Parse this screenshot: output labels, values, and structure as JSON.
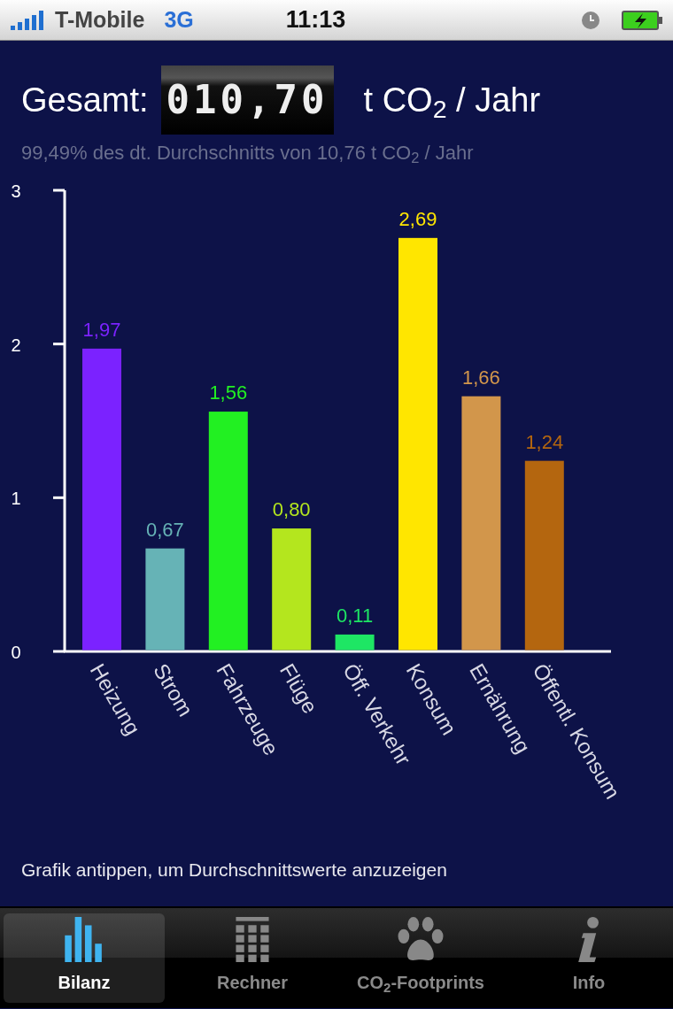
{
  "status_bar": {
    "carrier": "T-Mobile",
    "network": "3G",
    "time": "11:13"
  },
  "header": {
    "label": "Gesamt:",
    "counter": "010,70",
    "unit": "t CO$_{2}$ / Jahr",
    "comparison": "99,49% des dt. Durchschnitts von 10,76 t CO$_{2}$ / Jahr"
  },
  "chart_data": {
    "type": "bar",
    "categories": [
      "Heizung",
      "Strom",
      "Fahrzeuge",
      "Flüge",
      "Öff. Verkehr",
      "Konsum",
      "Ernährung",
      "Öffentl. Konsum"
    ],
    "series": [
      {
        "values": [
          1.97,
          0.67,
          1.56,
          0.8,
          0.11,
          2.69,
          1.66,
          1.24
        ]
      }
    ],
    "colors": [
      "#7b22ff",
      "#66b3b6",
      "#22f022",
      "#b4e61e",
      "#1ee664",
      "#ffe600",
      "#d2964b",
      "#b4660f"
    ],
    "value_labels": [
      "1,97",
      "0,67",
      "1,56",
      "0,80",
      "0,11",
      "2,69",
      "1,66",
      "1,24"
    ],
    "ylim": [
      0,
      3
    ],
    "yticks": [
      0,
      1,
      2,
      3
    ]
  },
  "hint": "Grafik antippen, um Durchschnittswerte anzuzeigen",
  "tabs": [
    {
      "label": "Bilanz",
      "kind": "chart",
      "selected": true
    },
    {
      "label": "Rechner",
      "kind": "calculator",
      "selected": false
    },
    {
      "label": "CO$_{2}$-Footprints",
      "kind": "paw",
      "selected": false
    },
    {
      "label": "Info",
      "kind": "info",
      "selected": false
    }
  ]
}
